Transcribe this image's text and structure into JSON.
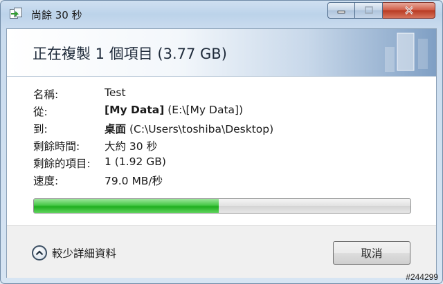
{
  "window": {
    "title": "尚餘 30 秒"
  },
  "main": {
    "heading": "正在複製 1 個項目 (3.77 GB)",
    "details": [
      {
        "label": "名稱:",
        "value_bold": "",
        "value": "Test"
      },
      {
        "label": "從:",
        "value_bold": "[My Data]",
        "value": " (E:\\[My Data])"
      },
      {
        "label": "到:",
        "value_bold": "桌面",
        "value": " (C:\\Users\\toshiba\\Desktop)"
      },
      {
        "label": "剩餘時間:",
        "value_bold": "",
        "value": "大約 30 秒"
      },
      {
        "label": "剩餘的項目:",
        "value_bold": "",
        "value": "1 (1.92 GB)"
      },
      {
        "label": "速度:",
        "value_bold": "",
        "value": "79.0 MB/秒"
      }
    ],
    "progress_percent": 49
  },
  "footer": {
    "details_toggle_label": "較少詳細資料",
    "cancel_label": "取消"
  },
  "watermark": "#244299",
  "colors": {
    "progress_green": "#2bb52b",
    "close_red": "#c9452d",
    "banner_blue": "#7f9fc4"
  }
}
